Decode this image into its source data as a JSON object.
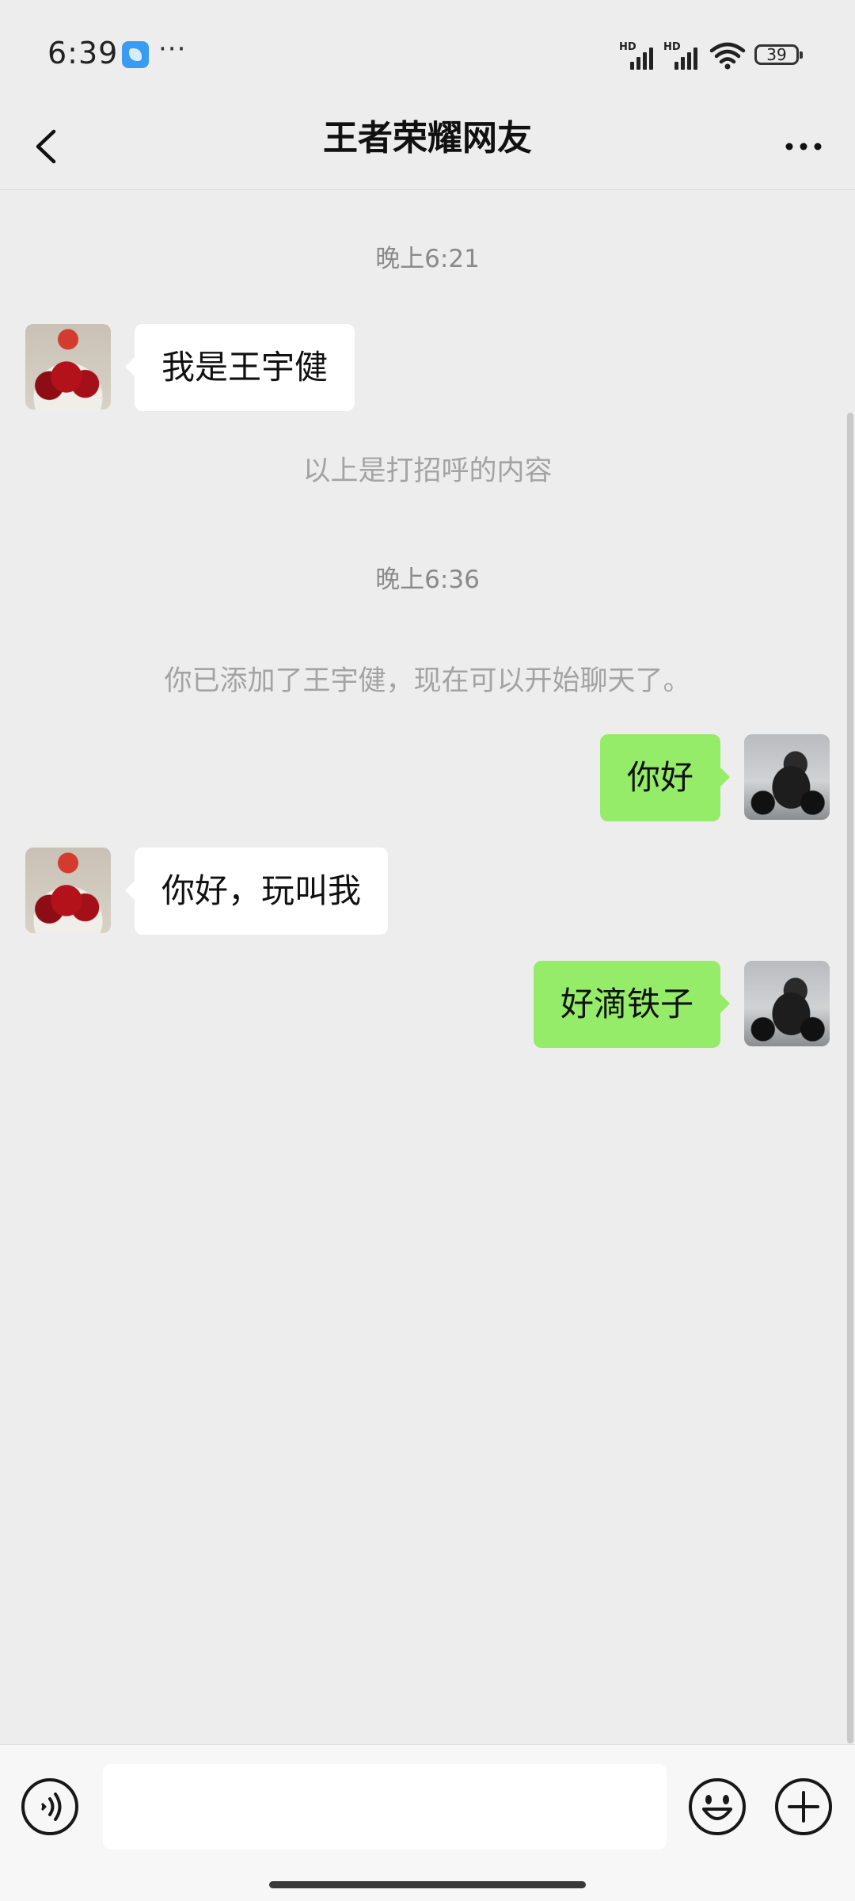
{
  "status_bar": {
    "time": "6:39",
    "app_icon": "blue-app-icon",
    "more_dots": "···",
    "signal_1_label": "HD",
    "signal_2_label": "HD",
    "wifi_icon": "wifi-icon",
    "battery_level": "39"
  },
  "header": {
    "title": "王者荣耀网友",
    "back_icon": "chevron-left-icon",
    "more_icon": "more-icon"
  },
  "chat": {
    "timestamps": [
      "晚上6:21",
      "晚上6:36"
    ],
    "system_notes": [
      "以上是打招呼的内容",
      "你已添加了王宇健，现在可以开始聊天了。"
    ],
    "messages": [
      {
        "side": "in",
        "text": "我是王宇健",
        "avatar": "roses-avatar"
      },
      {
        "side": "out",
        "text": "你好",
        "avatar": "motorcycle-avatar"
      },
      {
        "side": "in",
        "text": "你好，玩叫我",
        "avatar": "roses-avatar"
      },
      {
        "side": "out",
        "text": "好滴铁子",
        "avatar": "motorcycle-avatar"
      }
    ]
  },
  "input_bar": {
    "input_value": "",
    "voice_icon": "voice-icon",
    "emoji_icon": "emoji-icon",
    "plus_icon": "plus-icon"
  },
  "colors": {
    "background": "#ededed",
    "outgoing_bubble": "#95ec69",
    "incoming_bubble": "#ffffff",
    "timestamp_text": "#8a8a8a"
  }
}
